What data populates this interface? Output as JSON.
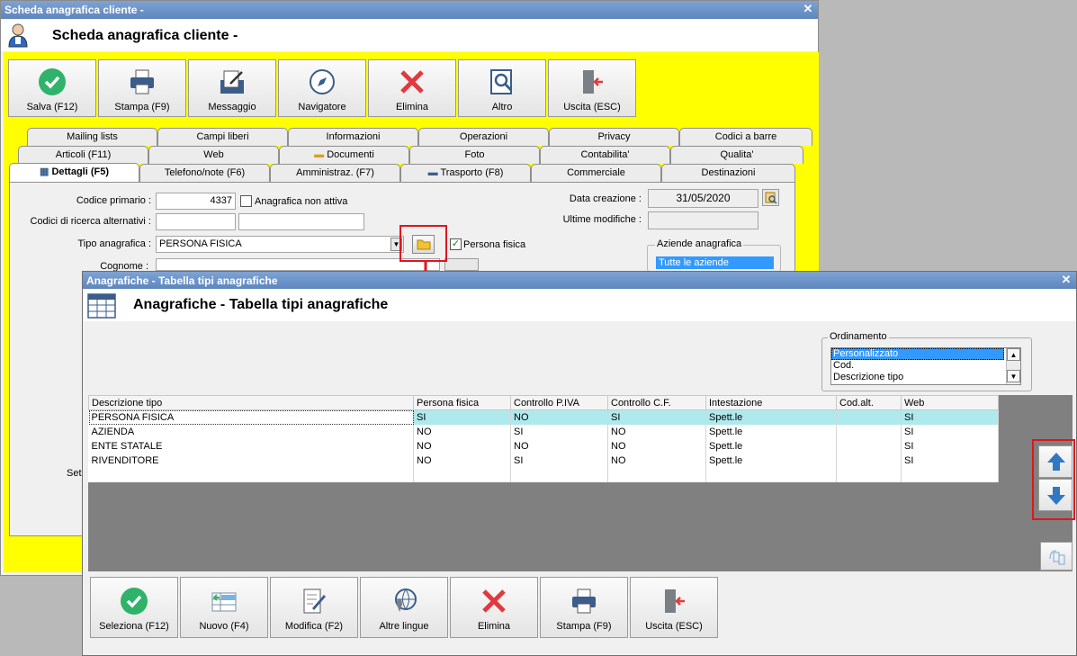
{
  "main_window": {
    "title": "Scheda anagrafica cliente -",
    "heading": "Scheda anagrafica cliente -",
    "toolbar": [
      {
        "label": "Salva (F12)",
        "icon": "check-icon"
      },
      {
        "label": "Stampa (F9)",
        "icon": "printer-icon"
      },
      {
        "label": "Messaggio",
        "icon": "message-icon"
      },
      {
        "label": "Navigatore",
        "icon": "compass-icon"
      },
      {
        "label": "Elimina",
        "icon": "delete-icon"
      },
      {
        "label": "Altro",
        "icon": "search-doc-icon"
      },
      {
        "label": "Uscita (ESC)",
        "icon": "exit-icon"
      }
    ],
    "tabs_row1": [
      "Mailing lists",
      "Campi liberi",
      "Informazioni",
      "Operazioni",
      "Privacy",
      "Codici a barre"
    ],
    "tabs_row2": [
      "Articoli (F11)",
      "Web",
      "Documenti",
      "Foto",
      "Contabilita'",
      "Qualita'"
    ],
    "tabs_row3": [
      "Dettagli (F5)",
      "Telefono/note (F6)",
      "Amministraz. (F7)",
      "Trasporto (F8)",
      "Commerciale",
      "Destinazioni"
    ],
    "form": {
      "codice_primario_label": "Codice primario :",
      "codice_primario_value": "4337",
      "non_attiva_label": "Anagrafica non attiva",
      "codici_ricerca_label": "Codici di ricerca alternativi :",
      "tipo_label": "Tipo anagrafica :",
      "tipo_value": "PERSONA FISICA",
      "persona_fisica_label": "Persona fisica",
      "cognome_label": "Cognome :",
      "data_creazione_label": "Data creazione :",
      "data_creazione_value": "31/05/2020",
      "ultime_modifiche_label": "Ultime modifiche :",
      "aziende_label": "Aziende anagrafica",
      "aziende_value": "Tutte le aziende",
      "partial_label": "Set"
    }
  },
  "dialog": {
    "title": "Anagrafiche - Tabella tipi anagrafiche",
    "heading": "Anagrafiche - Tabella tipi anagrafiche",
    "ordinamento": {
      "label": "Ordinamento",
      "options": [
        "Personalizzato",
        "Cod.",
        "Descrizione tipo"
      ]
    },
    "columns": [
      "Descrizione tipo",
      "Persona fisica",
      "Controllo P.IVA",
      "Controllo C.F.",
      "Intestazione",
      "Cod.alt.",
      "Web"
    ],
    "rows": [
      [
        "PERSONA FISICA",
        "SI",
        "NO",
        "SI",
        "Spett.le",
        "",
        "SI"
      ],
      [
        "AZIENDA",
        "NO",
        "SI",
        "NO",
        "Spett.le",
        "",
        "SI"
      ],
      [
        "ENTE STATALE",
        "NO",
        "NO",
        "NO",
        "Spett.le",
        "",
        "SI"
      ],
      [
        "RIVENDITORE",
        "NO",
        "SI",
        "NO",
        "Spett.le",
        "",
        "SI"
      ]
    ],
    "buttons": [
      {
        "label": "Seleziona (F12)",
        "icon": "check-icon"
      },
      {
        "label": "Nuovo (F4)",
        "icon": "new-record-icon"
      },
      {
        "label": "Modifica (F2)",
        "icon": "edit-icon"
      },
      {
        "label": "Altre lingue",
        "icon": "globe-icon"
      },
      {
        "label": "Elimina",
        "icon": "delete-icon"
      },
      {
        "label": "Stampa (F9)",
        "icon": "printer-icon"
      },
      {
        "label": "Uscita (ESC)",
        "icon": "exit-icon"
      }
    ]
  },
  "colors": {
    "accent_yellow": "#ffff00",
    "highlight_red": "#e0161c",
    "selection_blue": "#3399ff",
    "titlebar_blue": "#6a8fc6"
  }
}
